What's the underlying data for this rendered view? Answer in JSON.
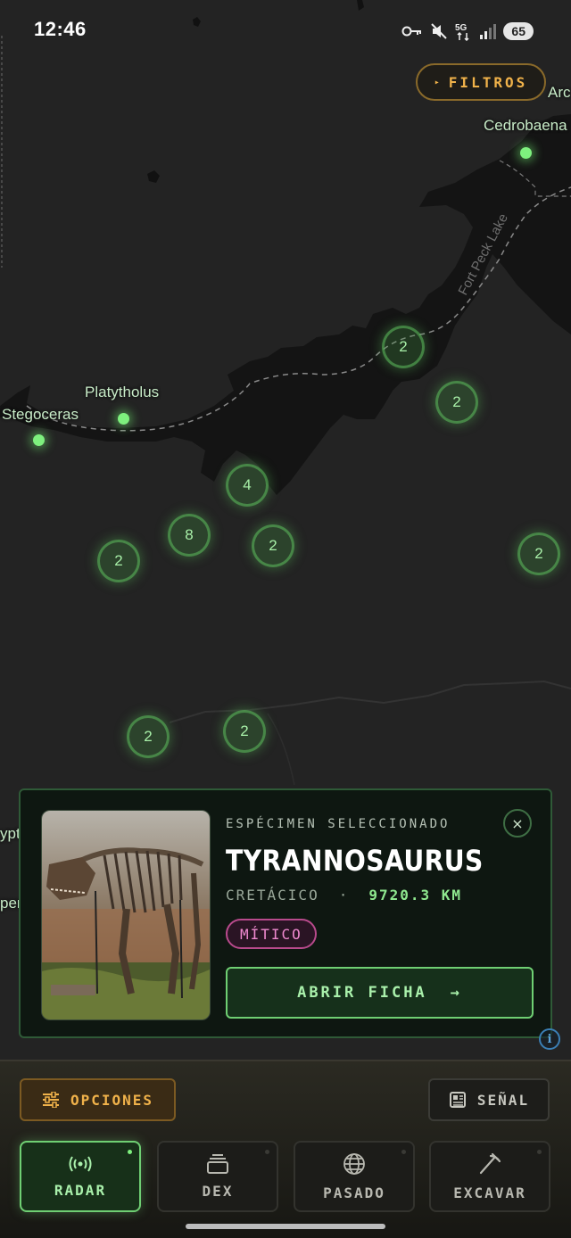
{
  "status_bar": {
    "time": "12:46",
    "battery": "65",
    "icons": [
      "key-icon",
      "mute-icon",
      "5g-icon",
      "signal-icon",
      "battery-icon"
    ]
  },
  "filters": {
    "label": "FILTROS"
  },
  "map": {
    "places": [
      {
        "name": "Cedrobaena"
      },
      {
        "name": "Platytholus"
      },
      {
        "name": "Stegoceras"
      },
      {
        "name": "Arc"
      },
      {
        "name": "yptos"
      },
      {
        "name": "pera"
      }
    ],
    "lake_label": "Fort Peck Lake",
    "clusters": [
      "2",
      "2",
      "4",
      "8",
      "2",
      "2",
      "2",
      "2",
      "2"
    ]
  },
  "card": {
    "kicker": "ESPÉCIMEN SELECCIONADO",
    "title": "TYRANNOSAURUS",
    "period": "CRETÁCICO",
    "separator": "·",
    "distance": "9720.3 KM",
    "rarity": "MÍTICO",
    "open_label": "ABRIR FICHA",
    "open_arrow": "→",
    "close_symbol": "×",
    "photo": "dinosaur-skeleton-photo"
  },
  "dock": {
    "options_label": "OPCIONES",
    "signal_label": "SEÑAL",
    "tabs": [
      {
        "label": "RADAR",
        "icon": "radar-icon",
        "active": true
      },
      {
        "label": "DEX",
        "icon": "cards-icon",
        "active": false
      },
      {
        "label": "PASADO",
        "icon": "globe-icon",
        "active": false
      },
      {
        "label": "EXCAVAR",
        "icon": "pickaxe-icon",
        "active": false
      }
    ]
  },
  "colors": {
    "map_bg": "#232323",
    "accent_green": "#7ef07e",
    "accent_amber": "#f0b24a",
    "rarity_pink": "#f08ad0"
  }
}
